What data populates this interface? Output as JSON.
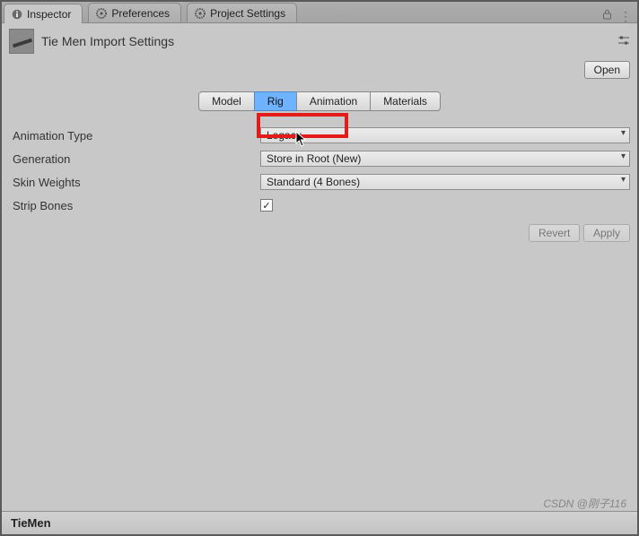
{
  "tabs": {
    "inspector": "Inspector",
    "preferences": "Preferences",
    "project": "Project Settings"
  },
  "asset": {
    "title": "Tie Men Import Settings",
    "open_btn": "Open"
  },
  "seg": {
    "model": "Model",
    "rig": "Rig",
    "animation": "Animation",
    "materials": "Materials"
  },
  "fields": {
    "anim_type_label": "Animation Type",
    "anim_type_value": "Legacy",
    "generation_label": "Generation",
    "generation_value": "Store in Root (New)",
    "skin_label": "Skin Weights",
    "skin_value": "Standard (4 Bones)",
    "strip_label": "Strip Bones",
    "strip_checked": true,
    "check_glyph": "✓"
  },
  "buttons": {
    "revert": "Revert",
    "apply": "Apply"
  },
  "footer": {
    "name": "TieMen"
  },
  "watermark": "CSDN @刚子116"
}
